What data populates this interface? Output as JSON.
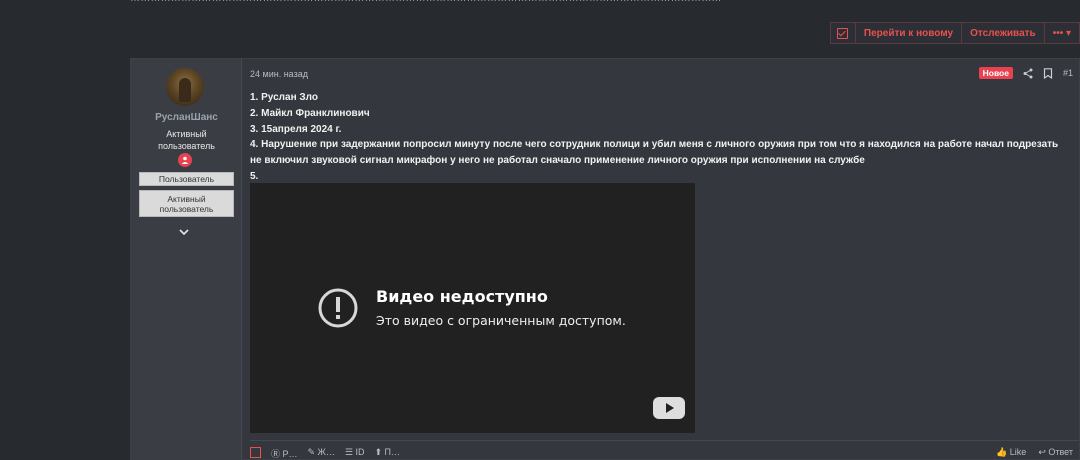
{
  "top_strip": {
    "text": "…………………………………………………………………………………………………………………………………………………………"
  },
  "thread_actions": {
    "go_new_label": "Перейти к новому",
    "watch_label": "Отслеживать",
    "more_label": "••• ▾"
  },
  "post": {
    "author": {
      "username": "РусланШанс",
      "user_title": "Активный пользователь",
      "banners": [
        "Пользователь",
        "Активный пользователь"
      ]
    },
    "time": "24 мин. назад",
    "new_badge": "Новое",
    "number": "#1",
    "body_lines": [
      "1. Руслан Зло",
      "2. Майкл Франклинович",
      "3. 15апреля 2024 г.",
      "4. Нарушение при задержании попросил минуту после чего сотрудник полици и убил меня с личного оружия при том что я находился на работе начал подрезать не включил звуковой сигнал микрафон у него не работал сначало применение личного оружия при исполнении на службе",
      "5."
    ],
    "video": {
      "title": "Видео недоступно",
      "subtitle": "Это видео с ограниченным доступом."
    },
    "footer": {
      "left": [
        "☐",
        "Ⓡ Р…",
        "✎ Ж…",
        "☰ ID",
        "⬆ П…"
      ],
      "right": [
        "👍 Like",
        "↩ Ответ"
      ]
    }
  },
  "colors": {
    "background": "#272a2f",
    "post_bg": "#34373d",
    "accent": "#e8514f",
    "video_bg": "#212121"
  }
}
